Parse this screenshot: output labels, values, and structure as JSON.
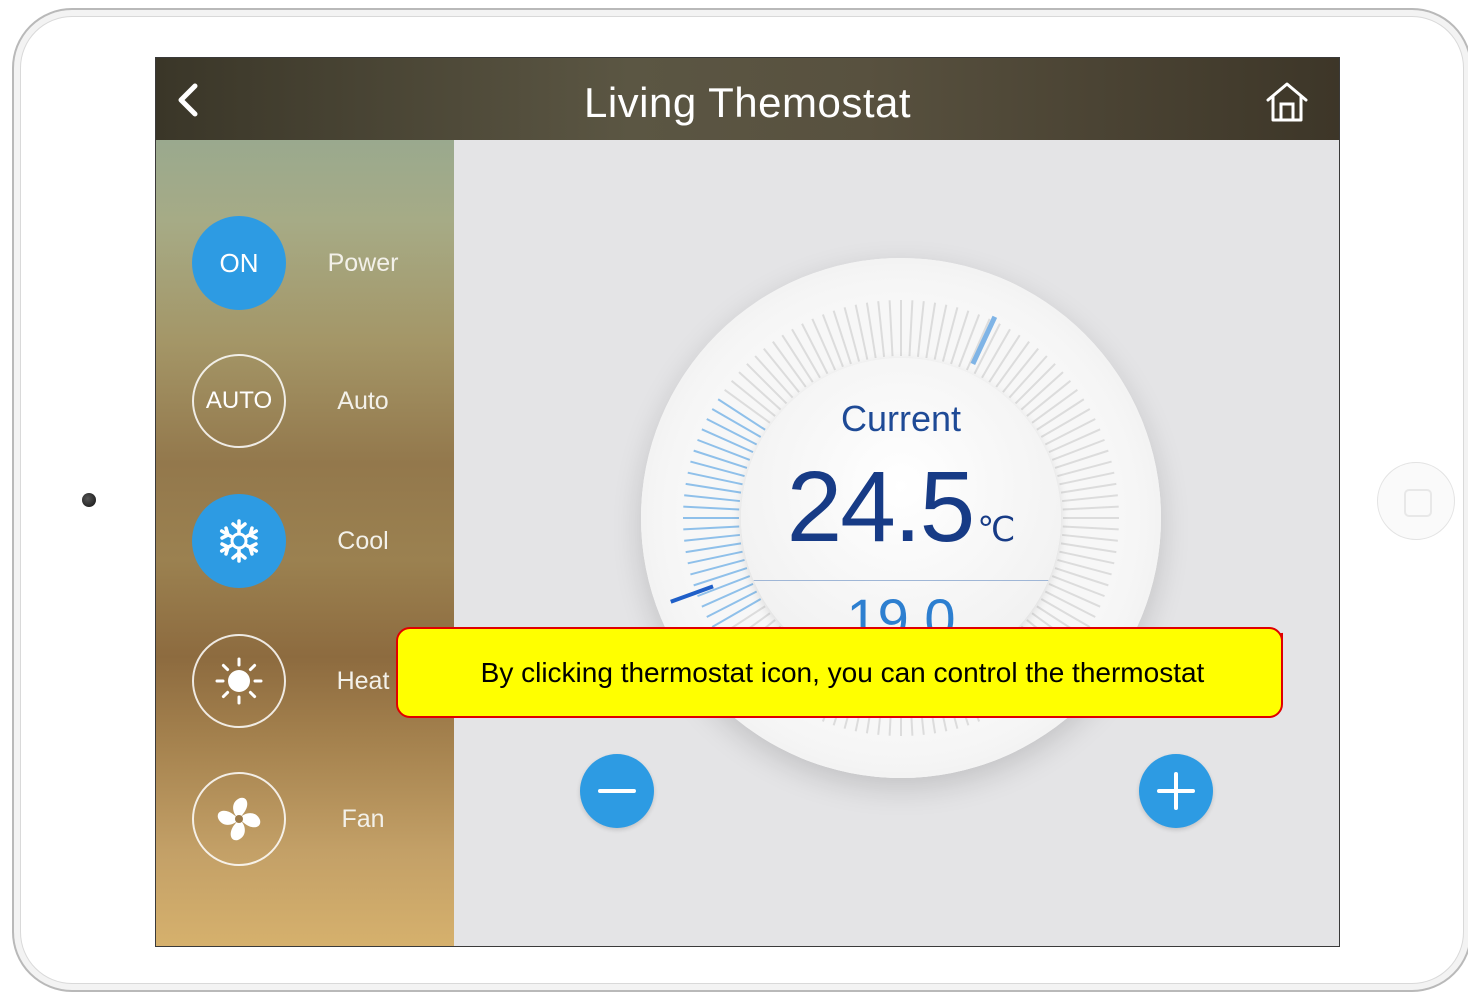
{
  "header": {
    "title": "Living Themostat",
    "back_icon": "chevron-left-icon",
    "home_icon": "home-icon"
  },
  "sidebar": {
    "modes": [
      {
        "badge": "ON",
        "label": "Power",
        "active": true
      },
      {
        "badge": "AUTO",
        "label": "Auto",
        "active": false
      },
      {
        "badge": "snowflake-icon",
        "label": "Cool",
        "active": true
      },
      {
        "badge": "sun-icon",
        "label": "Heat",
        "active": false
      },
      {
        "badge": "fan-icon",
        "label": "Fan",
        "active": false
      }
    ]
  },
  "thermostat": {
    "current_label": "Current",
    "current_temp": "24.5",
    "unit": "℃",
    "set_temp": "19.0"
  },
  "controls": {
    "decrease_icon": "minus-icon",
    "increase_icon": "plus-icon"
  },
  "callout": {
    "text": "By clicking thermostat icon, you can control the thermostat"
  },
  "colors": {
    "accent": "#2d9be3",
    "temp_text": "#173b86",
    "callout_bg": "#ffff00",
    "callout_border": "#e00000"
  }
}
